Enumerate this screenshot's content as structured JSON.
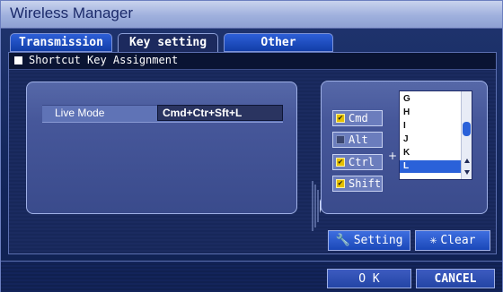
{
  "window": {
    "title": "Wireless Manager"
  },
  "tabs": [
    {
      "label": "Transmission",
      "active": false
    },
    {
      "label": "Key setting",
      "active": true
    },
    {
      "label": "Other",
      "active": false
    }
  ],
  "panel": {
    "title": "Shortcut Key Assignment",
    "assignment": {
      "label": "Live Mode",
      "value": "Cmd+Ctr+Sft+L"
    }
  },
  "modifiers": [
    {
      "label": "Cmd",
      "checked": true
    },
    {
      "label": "Alt",
      "checked": false
    },
    {
      "label": "Ctrl",
      "checked": true
    },
    {
      "label": "Shift",
      "checked": true
    }
  ],
  "plus": "+",
  "keys": {
    "items": [
      "G",
      "H",
      "I",
      "J",
      "K",
      "L"
    ],
    "selected": "L"
  },
  "buttons": {
    "setting": "Setting",
    "clear": "Clear",
    "ok": "O K",
    "cancel": "CANCEL"
  },
  "colors": {
    "accent": "#2a61d9",
    "check": "#e6c000"
  }
}
